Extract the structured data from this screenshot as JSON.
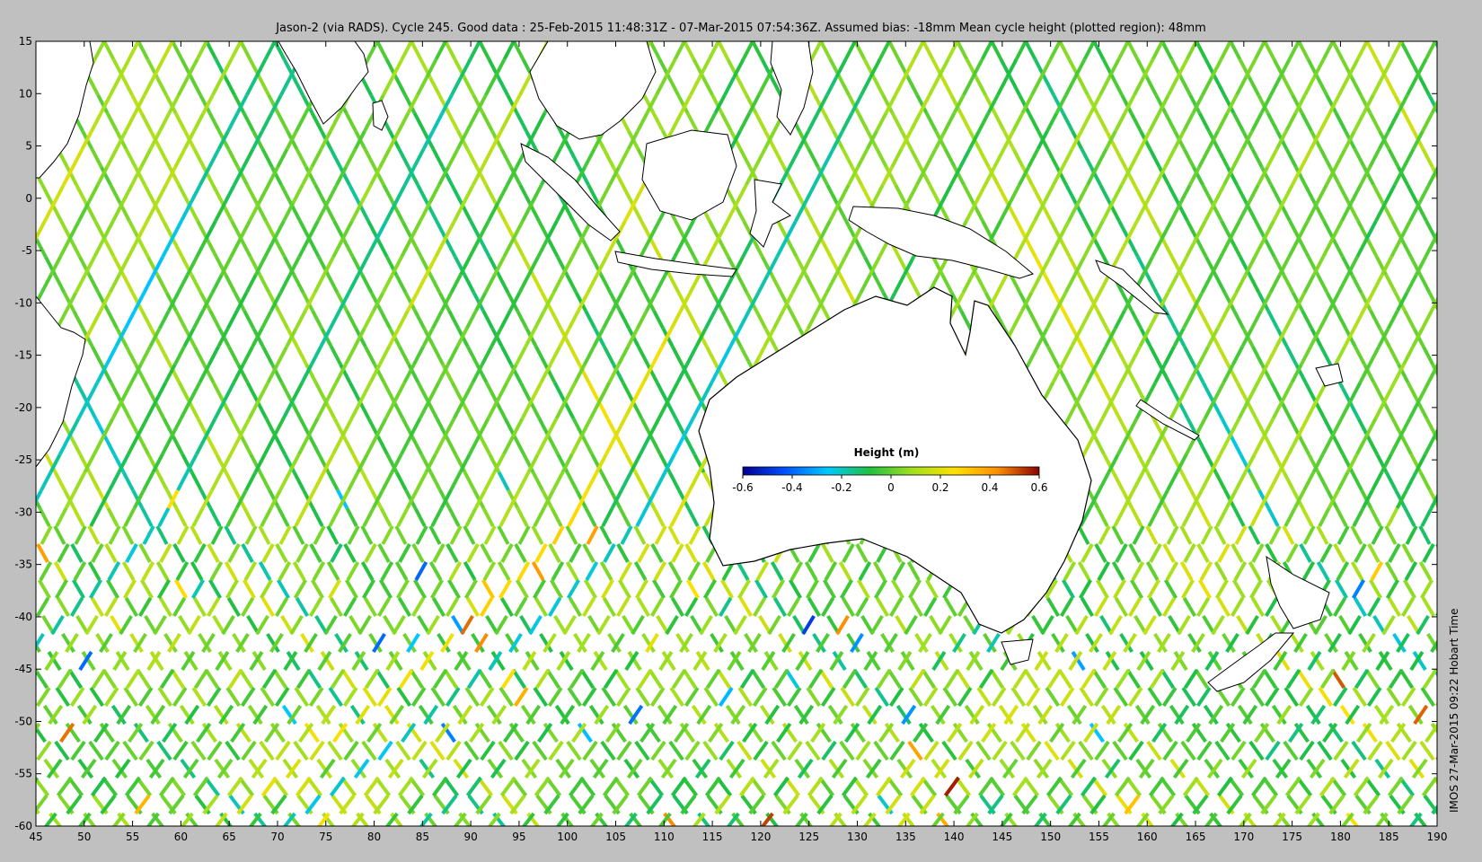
{
  "title": "Jason-2 (via RADS). Cycle 245. Good data : 25-Feb-2015 11:48:31Z - 07-Mar-2015 07:54:36Z. Assumed bias: -18mm  Mean cycle height (plotted region): 48mm",
  "side_label": "IMOS 27-Mar-2015 09:22 Hobart Time",
  "map": {
    "lon_range": [
      45,
      190
    ],
    "lat_range": [
      -60,
      15
    ],
    "x_ticks": [
      "45",
      "50",
      "55",
      "60",
      "65",
      "70",
      "75",
      "80",
      "85",
      "90",
      "95",
      "100",
      "105",
      "110",
      "115",
      "120",
      "125",
      "130",
      "135",
      "140",
      "145",
      "150",
      "155",
      "160",
      "165",
      "170",
      "175",
      "180",
      "185",
      "190"
    ],
    "y_ticks": [
      "15",
      "10",
      "5",
      "0",
      "-5",
      "-10",
      "-15",
      "-20",
      "-25",
      "-30",
      "-35",
      "-40",
      "-45",
      "-50",
      "-55",
      "-60"
    ],
    "background_color": "#ffffff",
    "coast_color": "#000000"
  },
  "colorbar": {
    "title": "Height (m)",
    "range": [
      -0.6,
      0.6
    ],
    "tick_labels": [
      "-0.6",
      "-0.4",
      "-0.2",
      "0",
      "0.2",
      "0.4",
      "0.6"
    ],
    "colormap": [
      "#00008f",
      "#0050ff",
      "#00c8ff",
      "#20c040",
      "#a0e020",
      "#ffe000",
      "#ff9000",
      "#8b0000"
    ]
  }
}
